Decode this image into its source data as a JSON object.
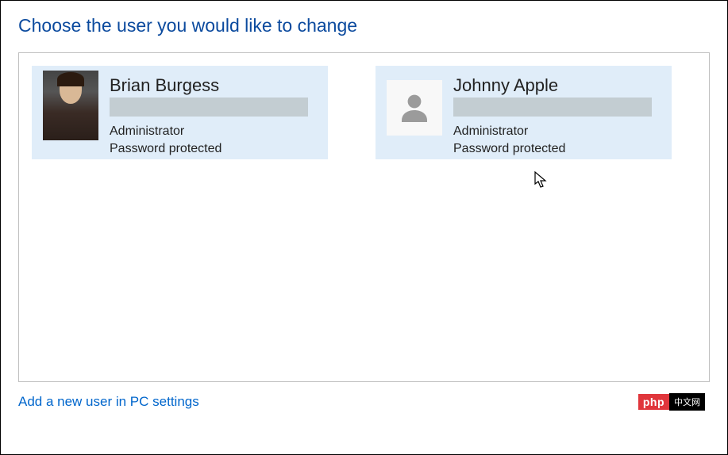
{
  "page_title": "Choose the user you would like to change",
  "users": [
    {
      "name": "Brian Burgess",
      "role": "Administrator",
      "status": "Password protected",
      "avatar_type": "photo"
    },
    {
      "name": "Johnny Apple",
      "role": "Administrator",
      "status": "Password protected",
      "avatar_type": "placeholder"
    }
  ],
  "add_user_link": "Add a new user in PC settings",
  "watermark": {
    "left": "php",
    "right": "中文网"
  }
}
